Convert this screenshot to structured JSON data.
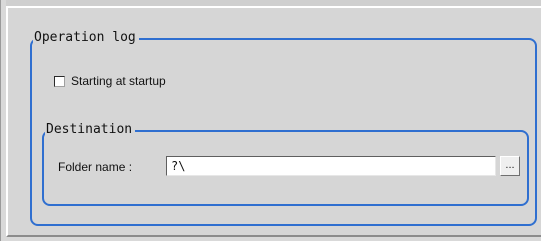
{
  "operation_log": {
    "group_label": "Operation log",
    "starting_at_startup_label": "Starting at startup",
    "starting_at_startup_checked": false
  },
  "destination": {
    "group_label": "Destination",
    "folder_name_label": "Folder name :",
    "folder_name_value": "?\\",
    "browse_label": "..."
  },
  "colors": {
    "group_border": "#2f6fd0",
    "panel_background": "#d6d6d6"
  }
}
